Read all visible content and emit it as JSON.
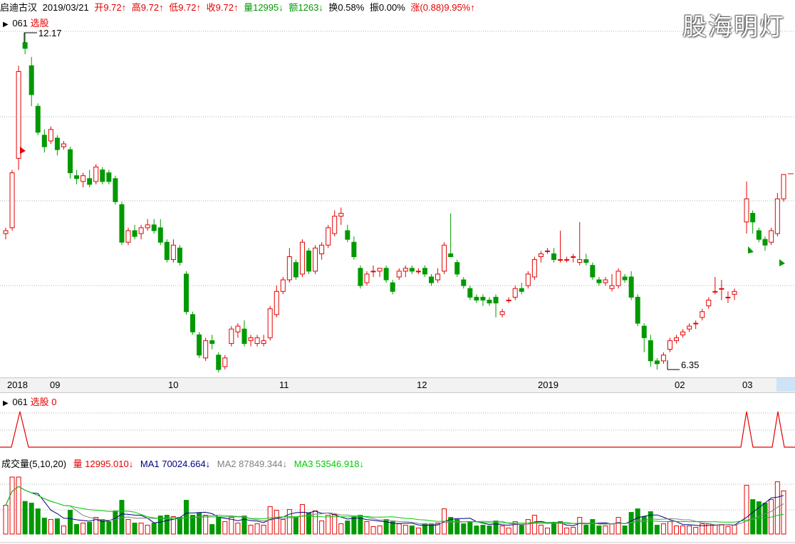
{
  "header": {
    "stock_name": "启迪古汉",
    "date": "2019/03/21",
    "open": "开9.72↑",
    "high": "高9.72↑",
    "low": "低9.72↑",
    "close": "收9.72↑",
    "volume": "量12995↓",
    "amount": "额1263↓",
    "turnover": "换0.58%",
    "amplitude": "振0.00%",
    "change": "涨(0.88)9.95%↑"
  },
  "watermark": "股海明灯",
  "main_panel": {
    "code": "061",
    "indicator": "选股",
    "high_label": "12.17",
    "low_label": "6.35"
  },
  "time_axis": [
    "2018",
    "09",
    "10",
    "11",
    "12",
    "2019",
    "02",
    "03"
  ],
  "signal_panel": {
    "code": "061",
    "indicator": "选股",
    "value": "0"
  },
  "volume_panel": {
    "title": "成交量(5,10,20)",
    "vol": "量 12995.010↓",
    "ma1": "MA1 70024.664↓",
    "ma2": "MA2 87849.344↓",
    "ma3": "MA3 53546.918↓"
  },
  "colors": {
    "up": "#e60000",
    "down": "#009900",
    "ma1": "#000080",
    "ma2": "#808080",
    "ma3": "#00cc00",
    "grid": "#b0b0b0"
  },
  "chart_data": {
    "type": "candlestick",
    "price_range": [
      6.35,
      12.17
    ],
    "candles": [
      [
        8.7,
        8.8,
        8.6,
        8.75
      ],
      [
        8.8,
        9.8,
        8.75,
        9.75
      ],
      [
        10.0,
        11.6,
        9.8,
        11.5
      ],
      [
        12.0,
        12.17,
        11.8,
        11.9
      ],
      [
        11.6,
        11.75,
        10.9,
        11.1
      ],
      [
        10.9,
        10.95,
        10.4,
        10.45
      ],
      [
        10.4,
        10.5,
        10.1,
        10.2
      ],
      [
        10.3,
        10.55,
        10.25,
        10.5
      ],
      [
        10.35,
        10.4,
        10.05,
        10.15
      ],
      [
        10.2,
        10.3,
        10.15,
        10.25
      ],
      [
        10.15,
        10.2,
        9.65,
        9.75
      ],
      [
        9.7,
        9.8,
        9.55,
        9.65
      ],
      [
        9.6,
        9.75,
        9.5,
        9.7
      ],
      [
        9.65,
        9.8,
        9.5,
        9.55
      ],
      [
        9.6,
        9.9,
        9.55,
        9.85
      ],
      [
        9.8,
        9.85,
        9.55,
        9.6
      ],
      [
        9.75,
        9.8,
        9.55,
        9.6
      ],
      [
        9.65,
        9.7,
        9.2,
        9.25
      ],
      [
        9.2,
        9.25,
        8.5,
        8.55
      ],
      [
        8.55,
        8.8,
        8.5,
        8.75
      ],
      [
        8.75,
        8.85,
        8.6,
        8.65
      ],
      [
        8.7,
        8.85,
        8.6,
        8.8
      ],
      [
        8.8,
        8.95,
        8.75,
        8.85
      ],
      [
        8.85,
        8.95,
        8.7,
        8.75
      ],
      [
        8.8,
        8.95,
        8.5,
        8.55
      ],
      [
        8.55,
        8.6,
        8.2,
        8.25
      ],
      [
        8.25,
        8.6,
        8.2,
        8.5
      ],
      [
        8.45,
        8.5,
        8.15,
        8.2
      ],
      [
        8.0,
        8.05,
        7.3,
        7.35
      ],
      [
        7.3,
        7.35,
        6.95,
        7.0
      ],
      [
        6.95,
        7.0,
        6.55,
        6.6
      ],
      [
        6.55,
        6.9,
        6.5,
        6.85
      ],
      [
        6.85,
        6.95,
        6.7,
        6.8
      ],
      [
        6.6,
        6.65,
        6.3,
        6.35
      ],
      [
        6.4,
        6.6,
        6.35,
        6.55
      ],
      [
        6.8,
        7.1,
        6.75,
        7.05
      ],
      [
        7.0,
        7.15,
        6.9,
        7.1
      ],
      [
        7.05,
        7.2,
        6.75,
        6.8
      ],
      [
        6.85,
        6.95,
        6.75,
        6.9
      ],
      [
        6.8,
        6.95,
        6.75,
        6.9
      ],
      [
        6.8,
        6.95,
        6.75,
        6.85
      ],
      [
        6.9,
        7.45,
        6.85,
        7.4
      ],
      [
        7.3,
        7.8,
        7.25,
        7.7
      ],
      [
        7.7,
        7.95,
        7.65,
        7.9
      ],
      [
        7.9,
        8.45,
        7.85,
        8.3
      ],
      [
        8.2,
        8.25,
        7.9,
        7.95
      ],
      [
        8.0,
        8.6,
        7.95,
        8.55
      ],
      [
        8.4,
        8.45,
        8.0,
        8.05
      ],
      [
        8.05,
        8.5,
        8.0,
        8.45
      ],
      [
        8.35,
        8.55,
        8.25,
        8.5
      ],
      [
        8.5,
        8.85,
        8.45,
        8.8
      ],
      [
        8.7,
        9.1,
        8.65,
        9.0
      ],
      [
        9.0,
        9.15,
        8.85,
        9.05
      ],
      [
        8.75,
        8.85,
        8.55,
        8.6
      ],
      [
        8.55,
        8.65,
        8.25,
        8.3
      ],
      [
        8.1,
        8.15,
        7.75,
        7.8
      ],
      [
        7.85,
        8.05,
        7.8,
        8.0
      ],
      [
        8.05,
        8.15,
        7.95,
        8.05
      ],
      [
        8.05,
        8.1,
        7.95,
        8.1
      ],
      [
        8.1,
        8.15,
        7.85,
        7.9
      ],
      [
        7.85,
        7.9,
        7.65,
        7.7
      ],
      [
        7.95,
        8.1,
        7.9,
        8.05
      ],
      [
        8.05,
        8.15,
        7.95,
        8.1
      ],
      [
        8.1,
        8.15,
        8.0,
        8.05
      ],
      [
        8.05,
        8.1,
        8.0,
        8.05
      ],
      [
        8.1,
        8.15,
        7.95,
        8.0
      ],
      [
        7.95,
        8.0,
        7.8,
        7.85
      ],
      [
        7.9,
        8.1,
        7.85,
        8.0
      ],
      [
        8.05,
        8.55,
        8.0,
        8.5
      ],
      [
        8.35,
        9.05,
        8.3,
        8.3
      ],
      [
        8.2,
        8.25,
        7.95,
        8.0
      ],
      [
        7.9,
        7.95,
        7.75,
        7.8
      ],
      [
        7.75,
        7.8,
        7.55,
        7.6
      ],
      [
        7.6,
        7.65,
        7.5,
        7.55
      ],
      [
        7.6,
        7.65,
        7.45,
        7.55
      ],
      [
        7.55,
        7.6,
        7.45,
        7.5
      ],
      [
        7.6,
        7.65,
        7.25,
        7.5
      ],
      [
        7.3,
        7.4,
        7.25,
        7.35
      ],
      [
        7.55,
        7.6,
        7.5,
        7.55
      ],
      [
        7.6,
        7.8,
        7.55,
        7.75
      ],
      [
        7.75,
        7.85,
        7.65,
        7.7
      ],
      [
        7.8,
        8.05,
        7.75,
        8.0
      ],
      [
        7.95,
        8.3,
        7.9,
        8.25
      ],
      [
        8.3,
        8.4,
        8.2,
        8.35
      ],
      [
        8.4,
        8.45,
        8.35,
        8.4
      ],
      [
        8.35,
        8.45,
        8.2,
        8.25
      ],
      [
        8.25,
        8.75,
        8.2,
        8.25
      ],
      [
        8.25,
        8.3,
        8.2,
        8.25
      ],
      [
        8.3,
        8.35,
        8.2,
        8.3
      ],
      [
        8.2,
        8.9,
        8.15,
        8.25
      ],
      [
        8.25,
        8.35,
        8.15,
        8.2
      ],
      [
        8.15,
        8.2,
        7.9,
        7.95
      ],
      [
        7.9,
        7.95,
        7.8,
        7.85
      ],
      [
        7.85,
        7.95,
        7.8,
        7.9
      ],
      [
        7.75,
        8.0,
        7.7,
        7.8
      ],
      [
        7.8,
        8.1,
        7.75,
        8.05
      ],
      [
        7.95,
        8.0,
        7.85,
        7.9
      ],
      [
        7.95,
        8.05,
        7.55,
        7.6
      ],
      [
        7.6,
        7.65,
        7.1,
        7.15
      ],
      [
        7.1,
        7.15,
        6.65,
        6.9
      ],
      [
        6.85,
        6.95,
        6.4,
        6.5
      ],
      [
        6.5,
        6.55,
        6.35,
        6.45
      ],
      [
        6.5,
        6.65,
        6.45,
        6.6
      ],
      [
        6.7,
        6.9,
        6.65,
        6.85
      ],
      [
        6.85,
        6.95,
        6.8,
        6.9
      ],
      [
        6.95,
        7.05,
        6.9,
        7.0
      ],
      [
        7.05,
        7.15,
        7.0,
        7.1
      ],
      [
        7.15,
        7.2,
        7.05,
        7.15
      ],
      [
        7.25,
        7.4,
        7.2,
        7.35
      ],
      [
        7.45,
        7.6,
        7.4,
        7.55
      ],
      [
        7.7,
        7.95,
        7.65,
        7.7
      ],
      [
        7.75,
        7.9,
        7.55,
        7.75
      ],
      [
        7.6,
        7.7,
        7.5,
        7.6
      ],
      [
        7.65,
        7.75,
        7.55,
        7.7
      ],
      [
        8.9,
        9.6,
        8.7,
        9.3
      ],
      [
        9.05,
        9.1,
        8.7,
        8.9
      ],
      [
        8.75,
        8.8,
        8.55,
        8.6
      ],
      [
        8.6,
        8.65,
        8.4,
        8.5
      ],
      [
        8.55,
        8.8,
        8.5,
        8.75
      ],
      [
        8.7,
        9.4,
        8.65,
        9.3
      ],
      [
        9.3,
        9.72,
        9.25,
        9.72
      ]
    ],
    "volume_max": 300000
  }
}
